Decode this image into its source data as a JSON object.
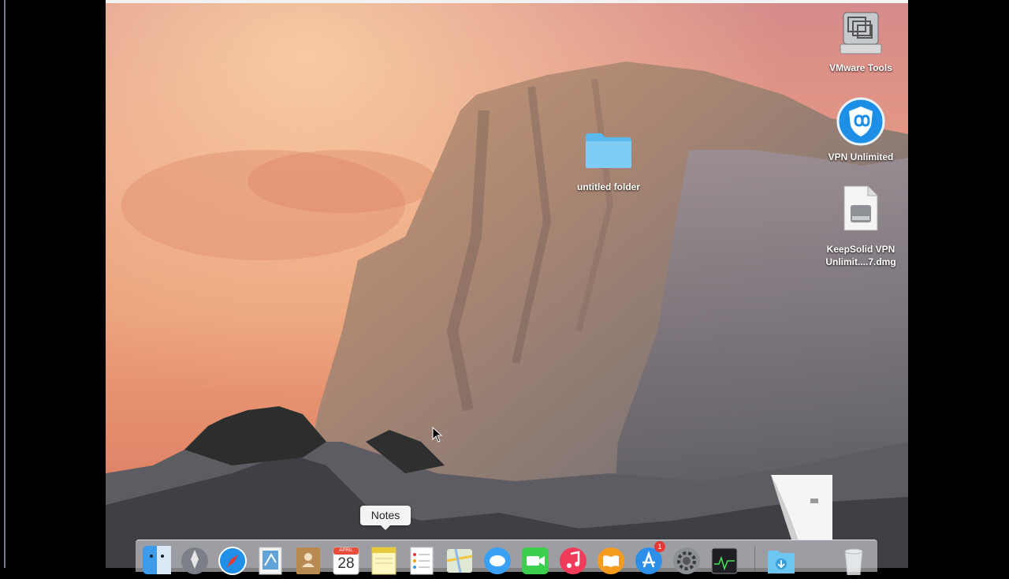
{
  "desktop_icons": {
    "vmware_tools": "VMware Tools",
    "vpn_unlimited": "VPN Unlimited",
    "keepsolid_dmg": "KeepSolid VPN\nUnlimit....7.dmg",
    "untitled_folder": "untitled folder"
  },
  "dock": {
    "tooltip": "Notes",
    "calendar_month": "APRIL",
    "calendar_day": "28",
    "app_store_badge": "1",
    "items": [
      "Finder",
      "Launchpad",
      "Safari",
      "Mail",
      "Contacts",
      "Calendar",
      "Notes",
      "Reminders",
      "Maps",
      "Messages",
      "FaceTime",
      "iTunes",
      "iBooks",
      "App Store",
      "System Preferences",
      "Activity Monitor",
      "Downloads",
      "Trash"
    ]
  },
  "colors": {
    "folder_blue": "#6cc6f2",
    "vpn_blue": "#1e8fe6",
    "app_store_blue": "#2d8fe8",
    "badge_red": "#e53935"
  }
}
